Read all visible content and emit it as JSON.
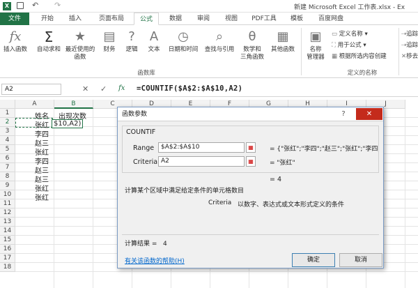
{
  "titlebar": {
    "title": "新建 Microsoft Excel 工作表.xlsx - Ex"
  },
  "tabs": [
    "文件",
    "开始",
    "插入",
    "页面布局",
    "公式",
    "数据",
    "审阅",
    "视图",
    "PDF工具",
    "模板",
    "百度网盘"
  ],
  "ribbon": {
    "insert_function": "插入函数",
    "autosum": "自动求和",
    "recent_used": "最近使用的\n函数",
    "financial": "财务",
    "logical": "逻辑",
    "text": "文本",
    "datetime": "日期和时间",
    "lookup": "查找与引用",
    "math": "数学和\n三角函数",
    "more": "其他函数",
    "library_label": "函数库",
    "name_manager": "名称\n管理器",
    "define_name": "定义名称",
    "use_in_formula": "用于公式",
    "create_from_selection": "根据所选内容创建",
    "defined_names_label": "定义的名称",
    "trace": "追踪",
    "trace2": "追踪",
    "remove": "移去"
  },
  "formula_bar": {
    "name_box": "A2",
    "fx": "fx",
    "formula": "=COUNTIF($A$2:$A$10,A2)"
  },
  "columns": [
    "A",
    "B",
    "C",
    "D",
    "E",
    "F",
    "G",
    "H",
    "I",
    "J"
  ],
  "rows": [
    "1",
    "2",
    "3",
    "4",
    "5",
    "6",
    "7",
    "8",
    "9",
    "10",
    "11",
    "12",
    "13",
    "14",
    "15",
    "16",
    "17",
    "18"
  ],
  "cells": {
    "a1": "姓名",
    "b1": "出现次数",
    "a2": "张红",
    "b2": "$10,A2)",
    "col_a": [
      "李四",
      "赵三",
      "张红",
      "李四",
      "赵三",
      "赵三",
      "张红",
      "张红"
    ]
  },
  "dialog": {
    "title": "函数参数",
    "fn_name": "COUNTIF",
    "range_label": "Range",
    "range_value": "$A$2:$A$10",
    "range_result": "= {\"张红\";\"李四\";\"赵三\";\"张红\";\"李四",
    "criteria_label": "Criteria",
    "criteria_value": "A2",
    "criteria_result": "= \"张红\"",
    "total_result": "= 4",
    "description": "计算某个区域中满足给定条件的单元格数目",
    "criteria_desc_name": "Criteria",
    "criteria_desc": "以数字、表达式或文本形式定义的条件",
    "calc_result": "计算结果 =   4",
    "help_link": "有关该函数的帮助(H)",
    "ok": "确定",
    "cancel": "取消",
    "help": "?",
    "close": "✕"
  },
  "colors": {
    "excel_green": "#217346",
    "dialog_border": "#7a9bc4",
    "link": "#0066cc"
  }
}
